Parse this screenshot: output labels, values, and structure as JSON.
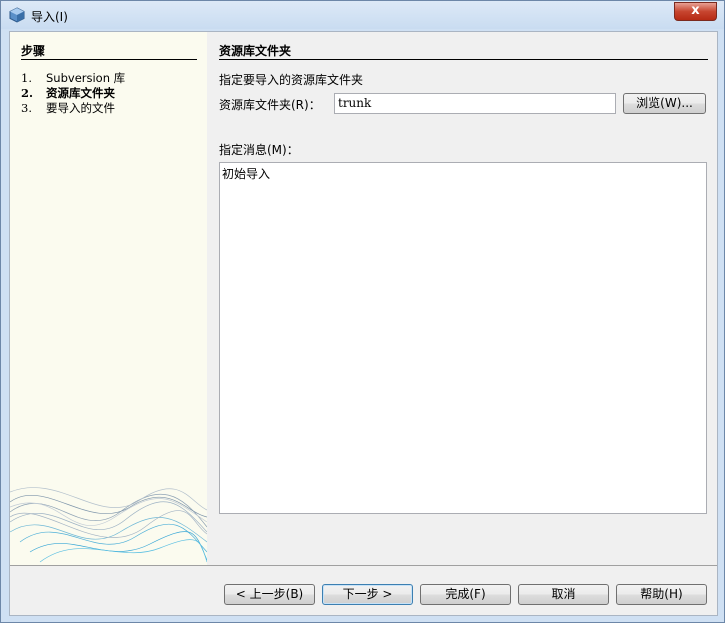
{
  "window": {
    "title": "导入(I)",
    "close_glyph": "x"
  },
  "steps": {
    "title": "步骤",
    "items": [
      {
        "num": "1.",
        "label": "Subversion 库"
      },
      {
        "num": "2.",
        "label": "资源库文件夹"
      },
      {
        "num": "3.",
        "label": "要导入的文件"
      }
    ],
    "current_index": 2
  },
  "main": {
    "section_title": "资源库文件夹",
    "instruction": "指定要导入的资源库文件夹",
    "folder_label": "资源库文件夹(R)：",
    "folder_value": "trunk",
    "browse_label": "浏览(W)...",
    "message_label": "指定消息(M)：",
    "message_value": "初始导入"
  },
  "footer": {
    "back_label": "< 上一步(B)",
    "next_label": "下一步 >",
    "finish_label": "完成(F)",
    "cancel_label": "取消",
    "help_label": "帮助(H)"
  },
  "colors": {
    "accent": "#3c7fb1",
    "steps_bg": "#fbfbef",
    "close": "#c7452f"
  }
}
